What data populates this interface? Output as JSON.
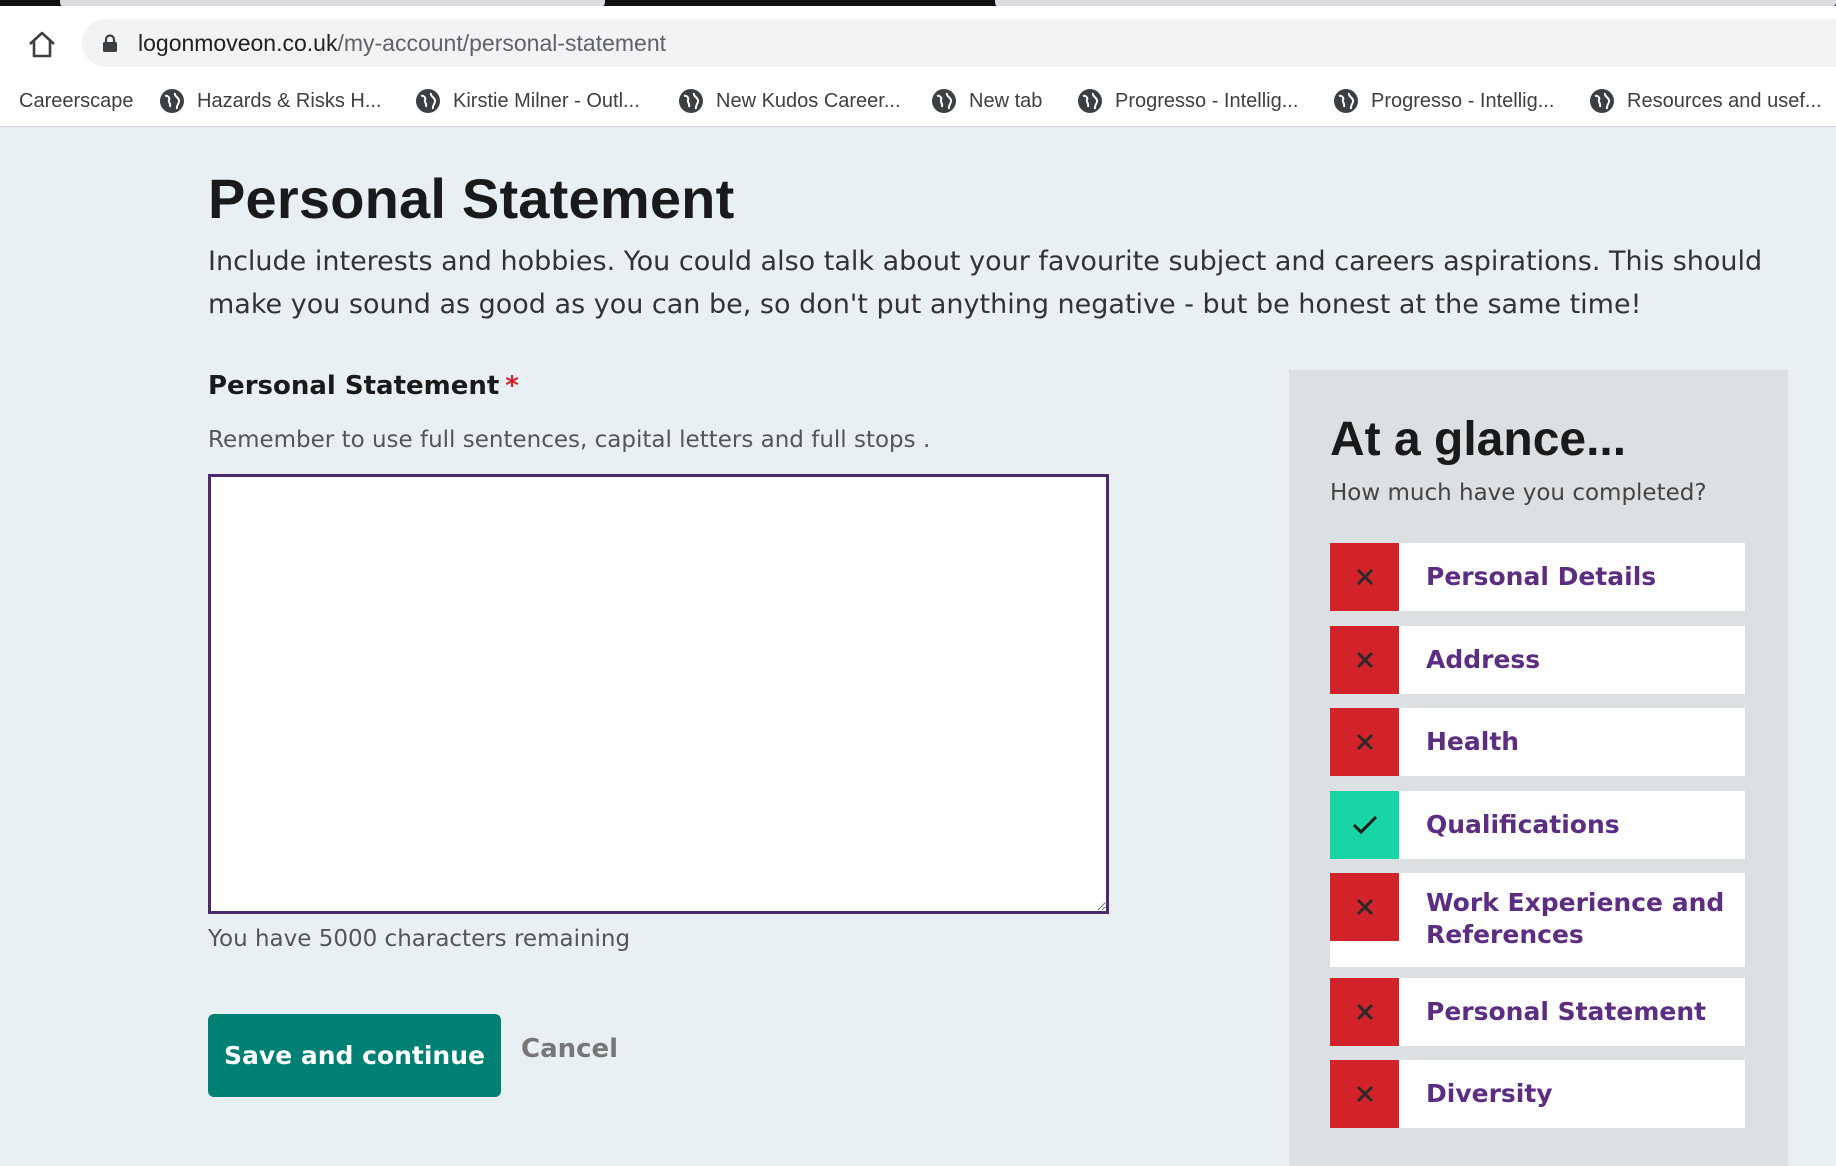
{
  "browser": {
    "url_domain": "logonmoveon.co.uk",
    "url_path": "/my-account/personal-statement",
    "bookmarks": [
      {
        "label": "Careerscape",
        "icon": "none"
      },
      {
        "label": "Hazards & Risks  H...",
        "icon": "globe-icon"
      },
      {
        "label": "Kirstie Milner - Outl...",
        "icon": "globe-icon"
      },
      {
        "label": "New Kudos Career...",
        "icon": "globe-icon"
      },
      {
        "label": "New tab",
        "icon": "globe-icon"
      },
      {
        "label": "Progresso - Intellig...",
        "icon": "globe-icon"
      },
      {
        "label": "Progresso - Intellig...",
        "icon": "globe-icon"
      },
      {
        "label": "Resources and usef...",
        "icon": "globe-icon"
      }
    ]
  },
  "page": {
    "title": "Personal Statement",
    "intro": "Include interests and hobbies. You could also talk about your favourite subject and careers aspirations. This should make you sound as good as you can be, so don't put anything negative - but be honest at the same time!"
  },
  "form": {
    "label": "Personal Statement",
    "required_marker": "*",
    "hint": "Remember to use full sentences, capital letters and full stops .",
    "value": "",
    "chars_remaining": "You have 5000 characters remaining",
    "save_label": "Save and continue",
    "cancel_label": "Cancel"
  },
  "glance": {
    "title": "At a glance...",
    "subtitle": "How much have you completed?",
    "items": [
      {
        "label": "Personal Details",
        "status": "incomplete",
        "icon": "cross-icon"
      },
      {
        "label": "Address",
        "status": "incomplete",
        "icon": "cross-icon"
      },
      {
        "label": "Health",
        "status": "incomplete",
        "icon": "cross-icon"
      },
      {
        "label": "Qualifications",
        "status": "complete",
        "icon": "check-icon"
      },
      {
        "label": "Work Experience and References",
        "status": "incomplete",
        "icon": "cross-icon"
      },
      {
        "label": "Personal Statement",
        "status": "incomplete",
        "icon": "cross-icon"
      },
      {
        "label": "Diversity",
        "status": "incomplete",
        "icon": "cross-icon"
      }
    ]
  },
  "colors": {
    "page_background": "#e8f0f3",
    "primary_button": "#007f73",
    "incomplete": "#d2232a",
    "complete": "#19d4a4",
    "link_purple": "#5c2d80",
    "textarea_border": "#4b2a6e"
  }
}
